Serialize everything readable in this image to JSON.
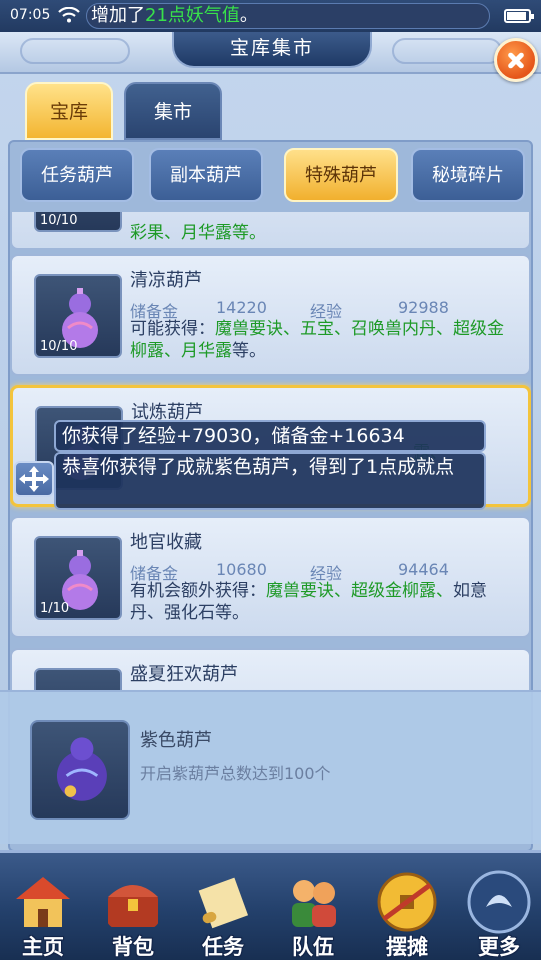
{
  "status_bar": {
    "time": "07:05",
    "notice_prefix": "增加了",
    "notice_highlight": "21点妖气值",
    "notice_suffix": "。",
    "battery_level": 0.9
  },
  "header": {
    "title": "宝库集市"
  },
  "tabs": [
    {
      "label": "宝库",
      "active": true
    },
    {
      "label": "集市",
      "active": false
    }
  ],
  "subtabs": [
    {
      "label": "任务葫芦",
      "active": false
    },
    {
      "label": "副本葫芦",
      "active": false
    },
    {
      "label": "特殊葫芦",
      "active": true
    },
    {
      "label": "秘境碎片",
      "active": false
    }
  ],
  "list": {
    "partial_top": {
      "qty": "10/10",
      "desc_tail": "彩果、月华露等。"
    },
    "items": [
      {
        "name": "清凉葫芦",
        "qty": "10/10",
        "reserve_label": "储备金",
        "reserve": "14220",
        "exp_label": "经验",
        "exp": "92988",
        "desc_lead": "可能获得：",
        "desc_items": "魔兽要诀、五宝、召唤兽内丹、超级金柳露、月华露",
        "desc_tail": "等。"
      },
      {
        "name": "试炼葫芦",
        "qty": "",
        "selected": true,
        "desc_partial": "露、"
      },
      {
        "name": "地官收藏",
        "qty": "1/10",
        "reserve_label": "储备金",
        "reserve": "10680",
        "exp_label": "经验",
        "exp": "94464",
        "desc_lead": "有机会额外获得：",
        "desc_items": "魔兽要诀、超级金柳露、",
        "desc_tail": "如意丹、强化石等。"
      },
      {
        "name": "盛夏狂欢葫芦"
      }
    ]
  },
  "toasts": [
    "你获得了经验+79030，储备金+16634",
    "恭喜你获得了成就紫色葫芦，得到了1点成就点"
  ],
  "achievement": {
    "title": "紫色葫芦",
    "desc": "开启紫葫芦总数达到100个"
  },
  "bottom_nav": [
    {
      "label": "主页",
      "icon": "house-icon"
    },
    {
      "label": "背包",
      "icon": "treasure-chest-icon"
    },
    {
      "label": "任务",
      "icon": "scroll-icon"
    },
    {
      "label": "队伍",
      "icon": "team-icon"
    },
    {
      "label": "摆摊",
      "icon": "coin-icon"
    },
    {
      "label": "更多",
      "icon": "more-icon"
    }
  ],
  "colors": {
    "accent_gold": "#f3b531",
    "highlight_green": "#1e9a27",
    "nav_blue": "#23406b"
  }
}
